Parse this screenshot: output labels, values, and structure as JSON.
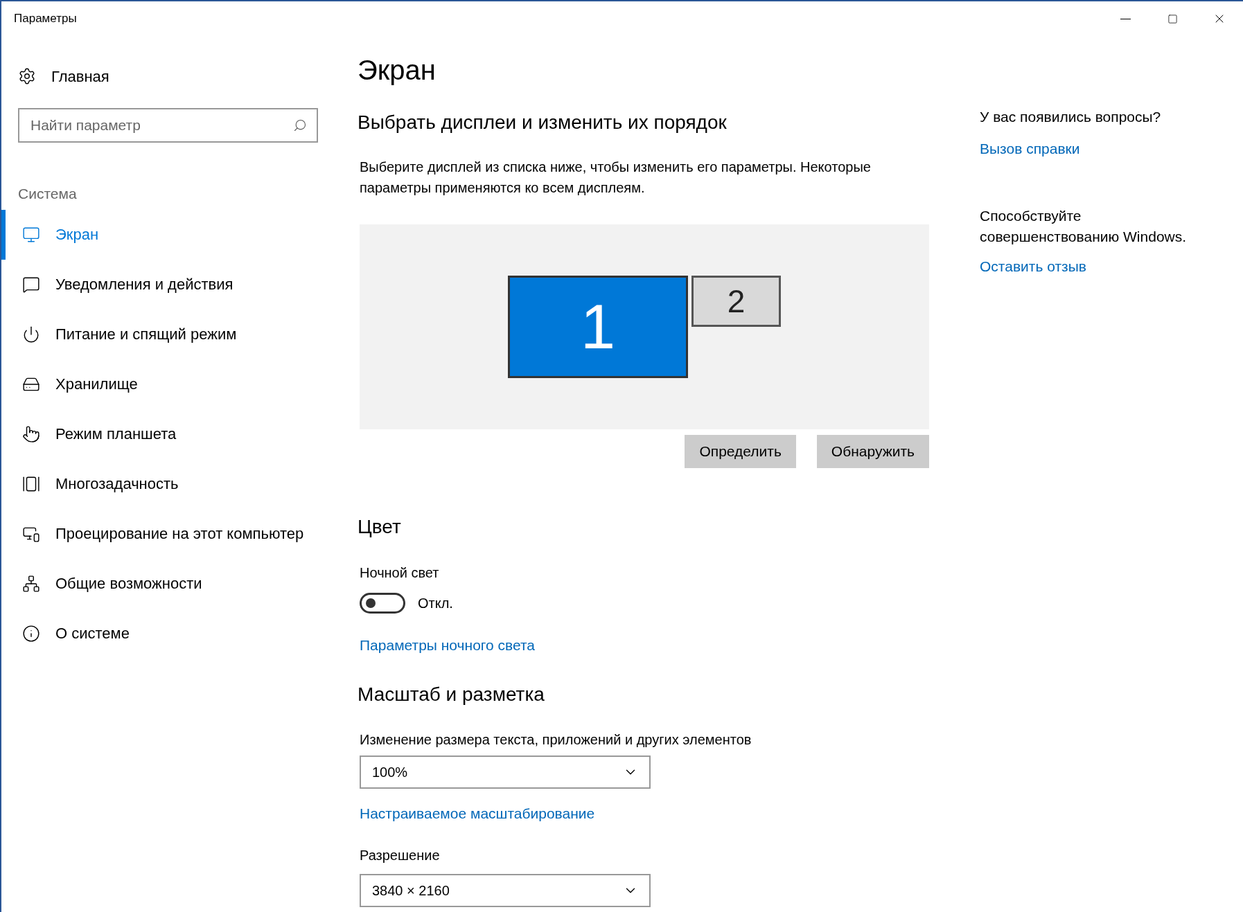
{
  "window": {
    "title": "Параметры"
  },
  "sidebar": {
    "home": "Главная",
    "search": {
      "placeholder": "Найти параметр"
    },
    "section": "Система",
    "items": [
      {
        "label": "Экран",
        "selected": true
      },
      {
        "label": "Уведомления и действия",
        "selected": false
      },
      {
        "label": "Питание и спящий режим",
        "selected": false
      },
      {
        "label": "Хранилище",
        "selected": false
      },
      {
        "label": "Режим планшета",
        "selected": false
      },
      {
        "label": "Многозадачность",
        "selected": false
      },
      {
        "label": "Проецирование на этот компьютер",
        "selected": false
      },
      {
        "label": "Общие возможности",
        "selected": false
      },
      {
        "label": "О системе",
        "selected": false
      }
    ]
  },
  "main": {
    "title": "Экран",
    "arrange": {
      "heading": "Выбрать дисплеи и изменить их порядок",
      "description": "Выберите дисплей из списка ниже, чтобы изменить его параметры. Некоторые параметры применяются ко всем дисплеям.",
      "displays": [
        {
          "label": "1",
          "selected": true
        },
        {
          "label": "2",
          "selected": false
        }
      ],
      "buttons": [
        "Определить",
        "Обнаружить"
      ]
    },
    "color": {
      "heading": "Цвет",
      "night_light": {
        "label": "Ночной свет",
        "on": false,
        "state_text": "Откл."
      },
      "link": "Параметры ночного света"
    },
    "scale": {
      "heading": "Масштаб и разметка",
      "size_label": "Изменение размера текста, приложений и других элементов",
      "size_value": "100%",
      "custom_link": "Настраиваемое масштабирование",
      "resolution_label": "Разрешение",
      "resolution_value": "3840 × 2160"
    }
  },
  "aside": {
    "question": "У вас появились вопросы?",
    "help_link": "Вызов справки",
    "improve": "Способствуйте совершенствованию Windows.",
    "feedback_link": "Оставить отзыв"
  }
}
